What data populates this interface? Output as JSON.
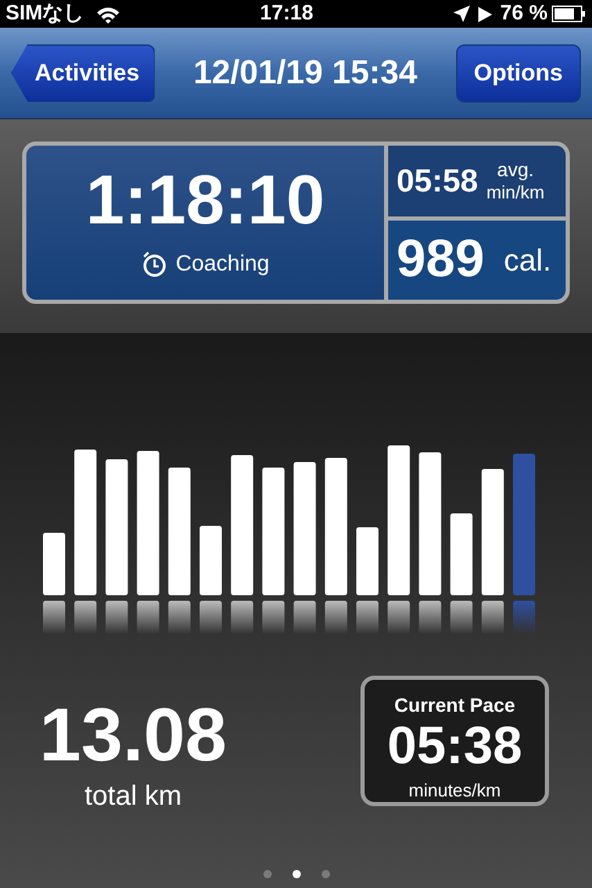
{
  "status_bar": {
    "carrier": "SIMなし",
    "time": "17:18",
    "battery": "76 %"
  },
  "nav_bar": {
    "back_button": "Activities",
    "title": "12/01/19 15:34",
    "right_button": "Options"
  },
  "summary": {
    "duration": "1:18:10",
    "coaching": "Coaching",
    "avg_pace": "05:58",
    "avg_label_1": "avg.",
    "avg_label_2": "min/km",
    "calories": "989",
    "calories_unit": "cal."
  },
  "distance": {
    "value": "13.08",
    "label": "total km"
  },
  "current_pace": {
    "title": "Current Pace",
    "value": "05:38",
    "unit": "minutes/km"
  },
  "pages": [
    {
      "selected": false
    },
    {
      "selected": true
    },
    {
      "selected": false
    }
  ]
}
